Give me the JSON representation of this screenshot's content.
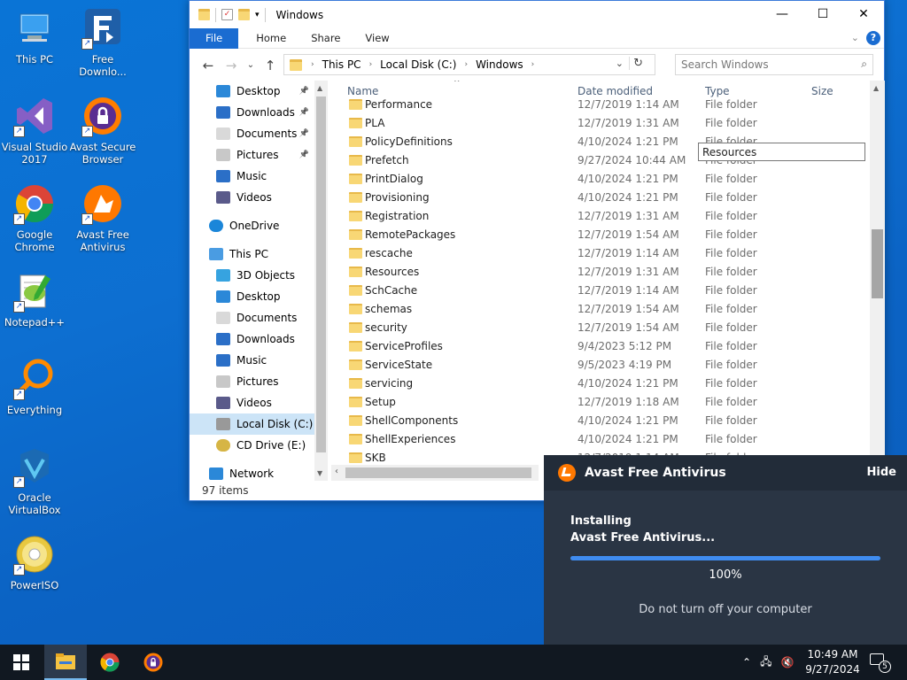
{
  "desktop": {
    "icons": [
      {
        "label": "This PC"
      },
      {
        "label": "Free Downlo..."
      },
      {
        "label": "Visual Studio 2017"
      },
      {
        "label": "Avast Secure Browser"
      },
      {
        "label": "Google Chrome"
      },
      {
        "label": "Avast Free Antivirus"
      },
      {
        "label": "Notepad++"
      },
      {
        "label": "Everything"
      },
      {
        "label": "Oracle VirtualBox"
      },
      {
        "label": "PowerISO"
      }
    ]
  },
  "explorer": {
    "title": "Windows",
    "ribbon_tabs": [
      "File",
      "Home",
      "Share",
      "View"
    ],
    "breadcrumb": [
      "This PC",
      "Local Disk (C:)",
      "Windows"
    ],
    "search_placeholder": "Search Windows",
    "columns": {
      "name": "Name",
      "date": "Date modified",
      "type": "Type",
      "size": "Size"
    },
    "nav": [
      {
        "label": "Desktop",
        "pinned": true
      },
      {
        "label": "Downloads",
        "pinned": true
      },
      {
        "label": "Documents",
        "pinned": true
      },
      {
        "label": "Pictures",
        "pinned": true
      },
      {
        "label": "Music"
      },
      {
        "label": "Videos"
      },
      {
        "label": "OneDrive"
      },
      {
        "label": "This PC"
      },
      {
        "label": "3D Objects"
      },
      {
        "label": "Desktop"
      },
      {
        "label": "Documents"
      },
      {
        "label": "Downloads"
      },
      {
        "label": "Music"
      },
      {
        "label": "Pictures"
      },
      {
        "label": "Videos"
      },
      {
        "label": "Local Disk (C:)",
        "selected": true
      },
      {
        "label": "CD Drive (E:)"
      },
      {
        "label": "Network"
      }
    ],
    "rows": [
      {
        "name": "Performance",
        "date": "12/7/2019 1:14 AM",
        "type": "File folder"
      },
      {
        "name": "PLA",
        "date": "12/7/2019 1:31 AM",
        "type": "File folder"
      },
      {
        "name": "PolicyDefinitions",
        "date": "4/10/2024 1:21 PM",
        "type": "File folder"
      },
      {
        "name": "Prefetch",
        "date": "9/27/2024 10:44 AM",
        "type": "File folder"
      },
      {
        "name": "PrintDialog",
        "date": "4/10/2024 1:21 PM",
        "type": "File folder"
      },
      {
        "name": "Provisioning",
        "date": "4/10/2024 1:21 PM",
        "type": "File folder"
      },
      {
        "name": "Registration",
        "date": "12/7/2019 1:31 AM",
        "type": "File folder"
      },
      {
        "name": "RemotePackages",
        "date": "12/7/2019 1:54 AM",
        "type": "File folder"
      },
      {
        "name": "rescache",
        "date": "12/7/2019 1:14 AM",
        "type": "File folder"
      },
      {
        "name": "Resources",
        "date": "12/7/2019 1:31 AM",
        "type": "File folder"
      },
      {
        "name": "SchCache",
        "date": "12/7/2019 1:14 AM",
        "type": "File folder"
      },
      {
        "name": "schemas",
        "date": "12/7/2019 1:54 AM",
        "type": "File folder"
      },
      {
        "name": "security",
        "date": "12/7/2019 1:54 AM",
        "type": "File folder"
      },
      {
        "name": "ServiceProfiles",
        "date": "9/4/2023 5:12 PM",
        "type": "File folder"
      },
      {
        "name": "ServiceState",
        "date": "9/5/2023 4:19 PM",
        "type": "File folder"
      },
      {
        "name": "servicing",
        "date": "4/10/2024 1:21 PM",
        "type": "File folder"
      },
      {
        "name": "Setup",
        "date": "12/7/2019 1:18 AM",
        "type": "File folder"
      },
      {
        "name": "ShellComponents",
        "date": "4/10/2024 1:21 PM",
        "type": "File folder"
      },
      {
        "name": "ShellExperiences",
        "date": "4/10/2024 1:21 PM",
        "type": "File folder"
      },
      {
        "name": "SKB",
        "date": "12/7/2019 1:14 AM",
        "type": "File folder"
      }
    ],
    "tooltip": "Resources",
    "status": "97 items"
  },
  "avast": {
    "title": "Avast Free Antivirus",
    "hide": "Hide",
    "line1": "Installing",
    "line2": "Avast Free Antivirus...",
    "progress": 100,
    "progress_label": "100%",
    "warning": "Do not turn off your computer"
  },
  "taskbar": {
    "time": "10:49 AM",
    "date": "9/27/2024",
    "notifications": "5"
  },
  "colors": {
    "accent": "#1a6cd1",
    "avast_orange": "#ff7800"
  }
}
